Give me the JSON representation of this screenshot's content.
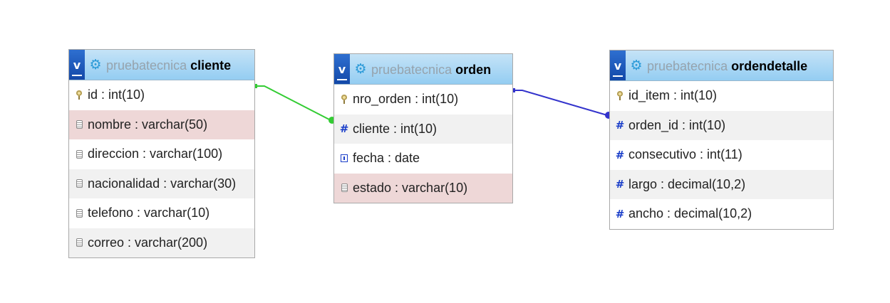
{
  "tables": [
    {
      "db": "pruebatecnica",
      "name": "cliente",
      "toggle_label": "v",
      "columns": [
        {
          "text": "id : int(10)",
          "icon": "key-icon",
          "style": "plain"
        },
        {
          "text": "nombre : varchar(50)",
          "icon": "text-icon",
          "style": "highlight"
        },
        {
          "text": "direccion : varchar(100)",
          "icon": "text-icon",
          "style": "plain"
        },
        {
          "text": "nacionalidad : varchar(30)",
          "icon": "text-icon",
          "style": "alt"
        },
        {
          "text": "telefono : varchar(10)",
          "icon": "text-icon",
          "style": "plain"
        },
        {
          "text": "correo : varchar(200)",
          "icon": "text-icon",
          "style": "alt"
        }
      ]
    },
    {
      "db": "pruebatecnica",
      "name": "orden",
      "toggle_label": "v",
      "columns": [
        {
          "text": "nro_orden : int(10)",
          "icon": "key-icon",
          "style": "plain"
        },
        {
          "text": "cliente : int(10)",
          "icon": "hash-icon",
          "style": "alt"
        },
        {
          "text": "fecha : date",
          "icon": "date-icon",
          "style": "plain"
        },
        {
          "text": "estado : varchar(10)",
          "icon": "text-icon",
          "style": "highlight"
        }
      ]
    },
    {
      "db": "pruebatecnica",
      "name": "ordendetalle",
      "toggle_label": "v",
      "columns": [
        {
          "text": "id_item : int(10)",
          "icon": "key-icon",
          "style": "plain"
        },
        {
          "text": "orden_id : int(10)",
          "icon": "hash-icon",
          "style": "alt"
        },
        {
          "text": "consecutivo : int(11)",
          "icon": "hash-icon",
          "style": "plain"
        },
        {
          "text": "largo : decimal(10,2)",
          "icon": "hash-icon",
          "style": "alt"
        },
        {
          "text": "ancho : decimal(10,2)",
          "icon": "hash-icon",
          "style": "plain"
        }
      ]
    }
  ],
  "relations": [
    {
      "from": "cliente.id",
      "to": "orden.cliente",
      "color": "#33cc33"
    },
    {
      "from": "ordendetalle.orden_id",
      "to": "orden.nro_orden",
      "color": "#3333cc"
    }
  ]
}
